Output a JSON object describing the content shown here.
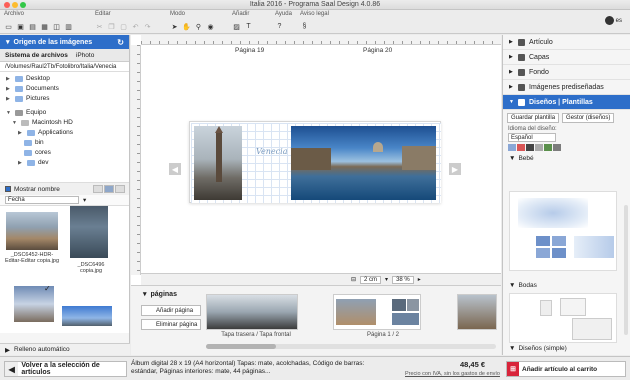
{
  "window": {
    "title": "Italia 2016 - Programa Saal Design 4.0.86"
  },
  "toolbar": {
    "groups": [
      {
        "label": "Archivo"
      },
      {
        "label": "Editar"
      },
      {
        "label": "Modo"
      },
      {
        "label": "Añadir"
      },
      {
        "label": "Ayuda"
      },
      {
        "label": "Aviso legal"
      }
    ],
    "language": "es"
  },
  "left": {
    "header": "Origen de las imágenes",
    "source_tabs": [
      "Sistema de archivos",
      "iPhoto"
    ],
    "path": "/Volumes/Raul2Tb/Fotolibro/Italia/Venecia",
    "tree": [
      {
        "label": "Desktop"
      },
      {
        "label": "Documents"
      },
      {
        "label": "Pictures"
      },
      {
        "label": "Equipo"
      },
      {
        "label": "Macintosh HD"
      },
      {
        "label": "Applications"
      },
      {
        "label": "bin"
      },
      {
        "label": "cores"
      },
      {
        "label": "dev"
      }
    ],
    "show_name": "Mostrar nombre",
    "sort": "Fecha",
    "thumbs": [
      {
        "label": "_DSC6452-HDR-Editar-Editar copia.jpg"
      },
      {
        "label": "_DSC6496 copia.jpg"
      }
    ],
    "autofill": "Relleno automático"
  },
  "canvas": {
    "page_left": "Página 19",
    "page_right": "Página 20",
    "script_text": "Venecia",
    "zoom_unit": "2 cm",
    "zoom_pct": "38 %"
  },
  "pages": {
    "title": "páginas",
    "add": "Añadir página",
    "remove": "Eliminar página",
    "caption_cover": "Tapa trasera / Tapa frontal",
    "caption_page": "Página 1 / 2"
  },
  "right": {
    "items": [
      "Artículo",
      "Capas",
      "Fondo",
      "Imágenes prediseñadas",
      "Diseños | Plantillas"
    ],
    "save_template": "Guardar plantilla",
    "manage": "Gestor (diseños)",
    "language_label": "Idioma del diseño:",
    "language_value": "Español",
    "swatches": [
      "#8aa7d6",
      "#d95656",
      "#444444",
      "#aaaaaa",
      "#5a8f4b",
      "#7c7c7c"
    ],
    "categories": [
      "Bebé",
      "Bodas",
      "Diseños (simple)"
    ]
  },
  "bottom": {
    "back": "Volver a la selección de artículos",
    "description": "Álbum digital 28 x 19 (A4 horizontal) Tapas: mate, acolchadas, Código de barras: estándar, Páginas interiores: mate, 44 páginas...",
    "price": "48,45 €",
    "price_note": "Precio con IVA, sin los gastos de envío",
    "cart": "Añadir artículo al carrito"
  }
}
